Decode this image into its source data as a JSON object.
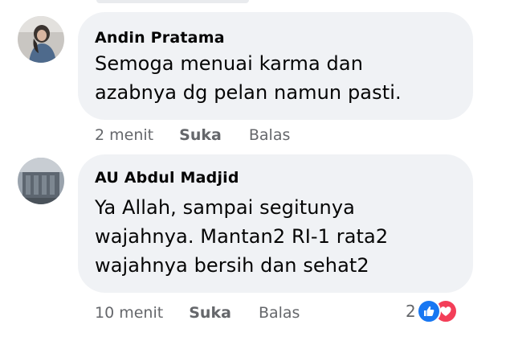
{
  "comments": [
    {
      "author": "Andin Pratama",
      "lines": [
        "Semoga menuai karma dan",
        "azabnya dg pelan namun pasti."
      ],
      "time": "2 menit",
      "like_label": "Suka",
      "reply_label": "Balas",
      "avatar_icon": "profile-photo-woman"
    },
    {
      "author": "AU Abdul Madjid",
      "lines": [
        "Ya Allah, sampai segitunya",
        "wajahnya. Mantan2 RI-1 rata2",
        "wajahnya bersih dan sehat2"
      ],
      "time": "10 menit",
      "like_label": "Suka",
      "reply_label": "Balas",
      "avatar_icon": "profile-photo-building",
      "reaction_count": "2",
      "reaction_icons": [
        "like-icon",
        "love-icon"
      ]
    }
  ],
  "colors": {
    "bubble": "#f0f2f5",
    "meta_text": "#65676b",
    "like_blue": "#1877f2",
    "love_red": "#f33e58"
  }
}
